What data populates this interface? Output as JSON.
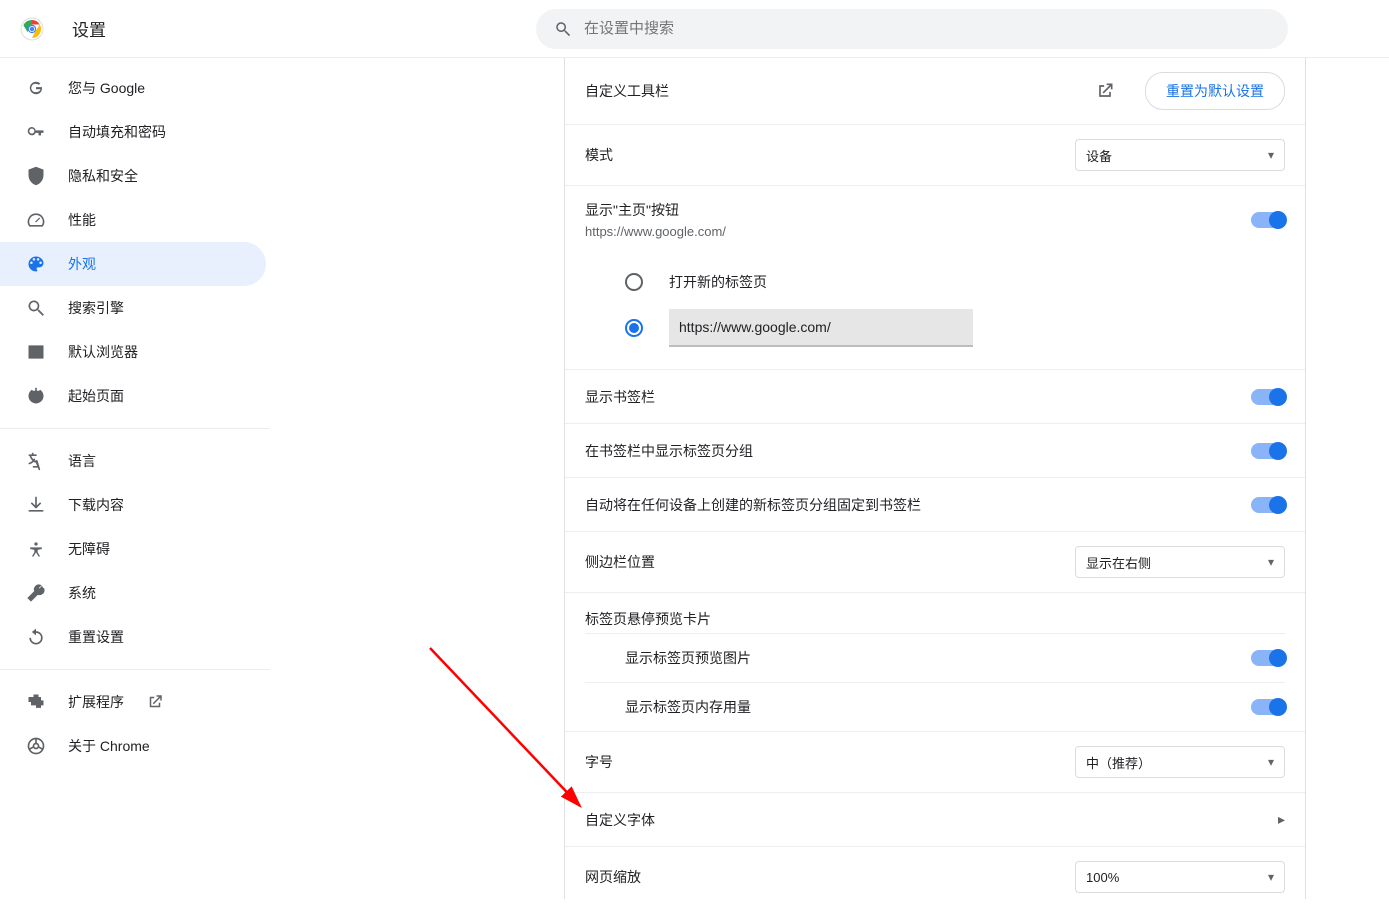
{
  "header": {
    "title": "设置",
    "search_placeholder": "在设置中搜索"
  },
  "sidebar": {
    "items": [
      {
        "label": "您与 Google"
      },
      {
        "label": "自动填充和密码"
      },
      {
        "label": "隐私和安全"
      },
      {
        "label": "性能"
      },
      {
        "label": "外观"
      },
      {
        "label": "搜索引擎"
      },
      {
        "label": "默认浏览器"
      },
      {
        "label": "起始页面"
      }
    ],
    "items2": [
      {
        "label": "语言"
      },
      {
        "label": "下载内容"
      },
      {
        "label": "无障碍"
      },
      {
        "label": "系统"
      },
      {
        "label": "重置设置"
      }
    ],
    "items3": [
      {
        "label": "扩展程序"
      },
      {
        "label": "关于 Chrome"
      }
    ]
  },
  "main": {
    "customize_toolbar": "自定义工具栏",
    "reset_default": "重置为默认设置",
    "mode_label": "模式",
    "mode_value": "设备",
    "home_button_label": "显示\"主页\"按钮",
    "home_button_sub": "https://www.google.com/",
    "radio_newtab": "打开新的标签页",
    "radio_url_value": "https://www.google.com/",
    "show_bookmarks": "显示书签栏",
    "show_tab_groups": "在书签栏中显示标签页分组",
    "pin_tab_groups": "自动将在任何设备上创建的新标签页分组固定到书签栏",
    "side_panel_label": "侧边栏位置",
    "side_panel_value": "显示在右侧",
    "hover_card_title": "标签页悬停预览卡片",
    "hover_card_preview": "显示标签页预览图片",
    "hover_card_memory": "显示标签页内存用量",
    "font_size_label": "字号",
    "font_size_value": "中（推荐）",
    "custom_fonts": "自定义字体",
    "page_zoom_label": "网页缩放",
    "page_zoom_value": "100%"
  }
}
